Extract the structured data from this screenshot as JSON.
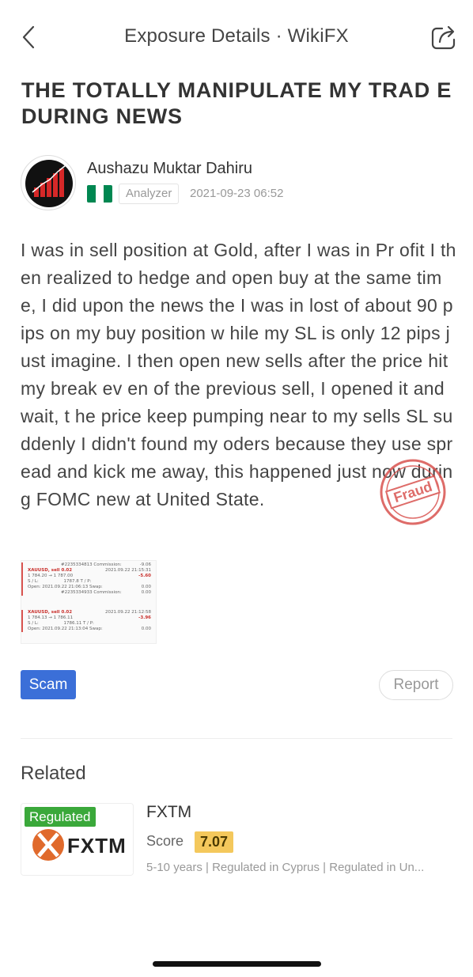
{
  "nav": {
    "title": "Exposure Details · WikiFX",
    "back_icon": "chevron-left-icon",
    "share_icon": "share-icon"
  },
  "article": {
    "title": "THE TOTALLY MANIPULATE MY TRAD E DURING NEWS",
    "author": {
      "name": "Aushazu Muktar Dahiru",
      "country_flag": "nigeria-flag",
      "flag_colors": [
        "#008751",
        "#ffffff",
        "#008751"
      ],
      "role": "Analyzer",
      "timestamp": "2021-09-23 06:52"
    },
    "body": "I was in sell position at Gold, after I was in Pr ofit I then realized to hedge and open buy at the same time, I did upon the news the I was in lost of about 90 pips on my buy position w hile my SL is only 12 pips just imagine. I then open new sells after the price hit my break ev en of the previous sell, I opened it and wait, t he price keep pumping near to my sells SL su ddenly I didn't found my oders because they use spread and kick me away, this happened just now during FOMC new at United State.",
    "stamp_text": "Fraud",
    "attachment": {
      "trade1": {
        "id": "#2235334813",
        "commission_label": "Commission:",
        "commission_value": "-9.06",
        "symbol": "XAUUSD, sell 0.02",
        "date": "2021.09.22 21:15:31",
        "prices": "1 784.20 → 1 787.00",
        "pl": "-5.60",
        "sl_label": "S / L:",
        "sl_value": "1787.8",
        "tp_label": "T / P:",
        "open_label": "Open:",
        "open_value": "2021.09.22 21:06:13",
        "swap_label": "Swap:",
        "swap_value": "0.00"
      },
      "trade2": {
        "id": "#2235334933",
        "commission_label": "Commission:",
        "commission_value": "0.00",
        "symbol": "XAUUSD, sell 0.02",
        "date": "2021.09.22 21:12:58",
        "prices": "1 784.13 → 1 786.11",
        "pl": "-3.96",
        "sl_label": "S / L:",
        "sl_value": "1786.11",
        "tp_label": "T / P:",
        "open_label": "Open:",
        "open_value": "2021.09.22 21:13:04",
        "swap_label": "Swap:",
        "swap_value": "0.00"
      }
    },
    "tag": "Scam",
    "report_label": "Report"
  },
  "related": {
    "heading": "Related",
    "items": [
      {
        "badge": "Regulated",
        "logo_text": "FXTM",
        "name": "FXTM",
        "score_label": "Score",
        "score": "7.07",
        "meta": "5-10 years | Regulated in Cyprus | Regulated in Un..."
      }
    ]
  },
  "colors": {
    "scam_tag": "#3b6fd8",
    "regulated": "#3aa83a",
    "score": "#f4c85c",
    "fraud_stamp": "#d9534f",
    "fxtm_orange": "#e06a2c"
  }
}
